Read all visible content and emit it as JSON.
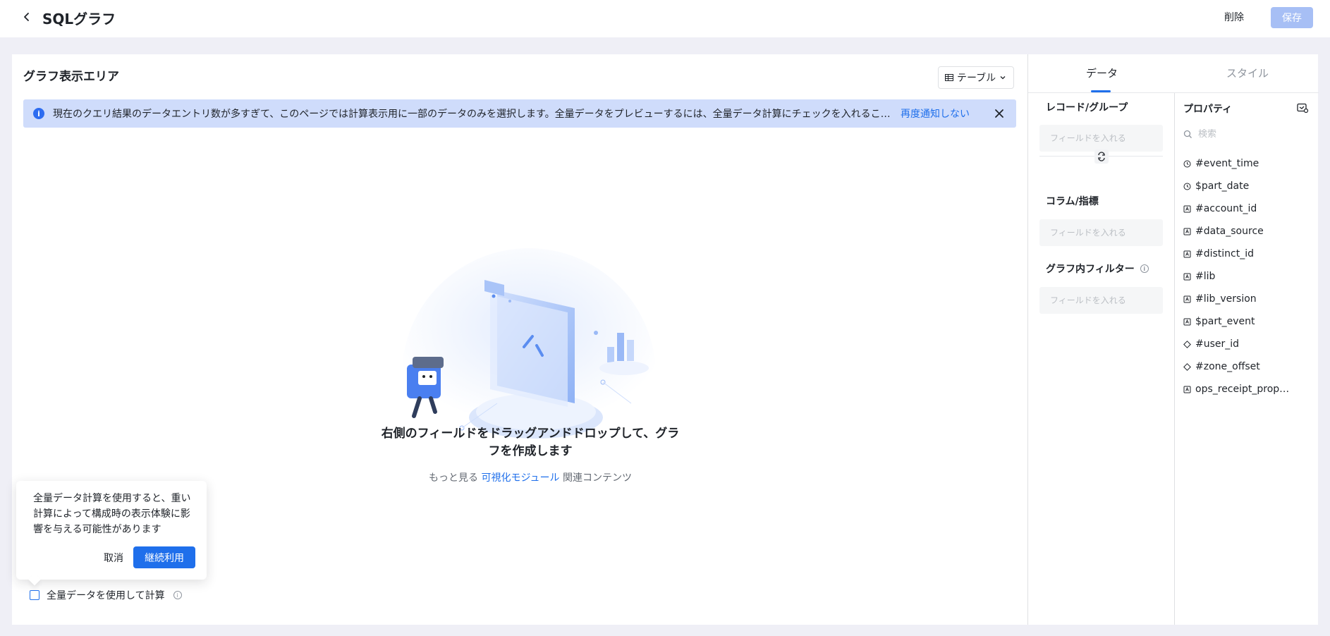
{
  "header": {
    "title": "SQLグラフ",
    "delete_label": "削除",
    "save_label": "保存"
  },
  "chart_area": {
    "title": "グラフ表示エリア",
    "chart_type": "テーブル",
    "notice": {
      "text": "現在のクエリ結果のデータエントリ数が多すぎて、このページでは計算表示用に一部のデータのみを選択します。全量データをプレビューするには、全量データ計算にチェックを入れるこ…",
      "link": "再度通知しない"
    },
    "empty_state": {
      "title": "右側のフィールドをドラッグアンドドロップして、グラフを作成します",
      "sub_prefix": "もっと見る",
      "sub_link": "可視化モジュール",
      "sub_suffix": "関連コンテンツ"
    },
    "popover": {
      "text": "全量データ計算を使用すると、重い計算によって構成時の表示体験に影響を与える可能性があります",
      "cancel_label": "取消",
      "continue_label": "継続利用"
    },
    "full_calc_label": "全量データを使用して計算"
  },
  "side": {
    "tabs": [
      {
        "label": "データ",
        "active": true
      },
      {
        "label": "スタイル",
        "active": false
      }
    ],
    "sections": {
      "record_group": "レコード/グループ",
      "column_metric": "コラム/指標",
      "chart_filter": "グラフ内フィルター"
    },
    "drop_placeholder": "フィールドを入れる",
    "properties": {
      "title": "プロパティ",
      "search_placeholder": "検索",
      "items": [
        {
          "label": "#event_time",
          "icon": "clock-icon"
        },
        {
          "label": "$part_date",
          "icon": "clock-icon"
        },
        {
          "label": "#account_id",
          "icon": "text-type-icon"
        },
        {
          "label": "#data_source",
          "icon": "text-type-icon"
        },
        {
          "label": "#distinct_id",
          "icon": "text-type-icon"
        },
        {
          "label": "#lib",
          "icon": "text-type-icon"
        },
        {
          "label": "#lib_version",
          "icon": "text-type-icon"
        },
        {
          "label": "$part_event",
          "icon": "text-type-icon"
        },
        {
          "label": "#user_id",
          "icon": "number-type-icon"
        },
        {
          "label": "#zone_offset",
          "icon": "number-type-icon"
        },
        {
          "label": "ops_receipt_properties",
          "icon": "text-type-icon"
        }
      ]
    }
  },
  "colors": {
    "accent": "#1f6feb",
    "notice_bg": "#cfdcfb",
    "save_disabled": "#a7bff5"
  }
}
